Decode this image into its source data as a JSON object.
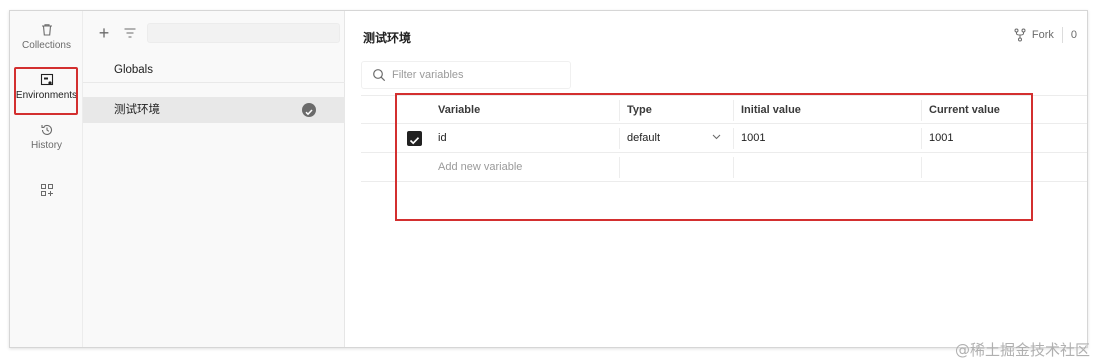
{
  "rail": {
    "items": [
      {
        "label": "Collections",
        "icon": "trash-icon"
      },
      {
        "label": "Environments",
        "icon": "environment-icon"
      },
      {
        "label": "History",
        "icon": "history-icon"
      },
      {
        "label": "",
        "icon": "configure-workspace-icon"
      }
    ]
  },
  "env_list": {
    "items": [
      {
        "label": "Globals"
      },
      {
        "label": "测试环境",
        "active": true
      }
    ]
  },
  "main": {
    "title": "测试环境",
    "fork_label": "Fork",
    "fork_count": "0",
    "filter_placeholder": "Filter variables",
    "columns": [
      "Variable",
      "Type",
      "Initial value",
      "Current value"
    ],
    "rows": [
      {
        "enabled": true,
        "variable": "id",
        "type": "default",
        "initial": "1001",
        "current": "1001"
      }
    ],
    "add_placeholder": "Add new variable"
  },
  "colors": {
    "highlight_red": "#d32f2f",
    "sidebar_bg": "#f9f9f9",
    "active_item_bg": "#e8e8e8"
  },
  "watermark": "@稀土掘金技术社区"
}
